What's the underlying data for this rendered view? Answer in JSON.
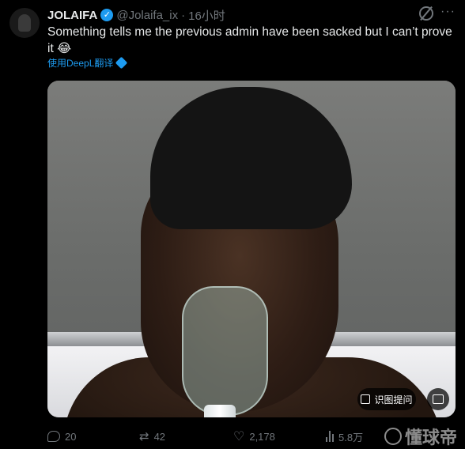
{
  "author": {
    "name": "JOLAIFA",
    "handle": "@Jolaifa_ix",
    "separator": "·",
    "time": "16小时"
  },
  "tweet": {
    "text": "Something tells me the previous admin have been sacked but I can’t prove it 😂",
    "translate_label": "使用DeepL翻译"
  },
  "media": {
    "ocr_button_label": "识图提问"
  },
  "actions": {
    "replies": "20",
    "retweets": "42",
    "likes": "2,178",
    "views": "5.8万"
  },
  "watermark": {
    "text": "懂球帝"
  },
  "colors": {
    "background": "#000000",
    "accent": "#1d9bf0",
    "muted": "#71767b",
    "text": "#e7e9ea"
  }
}
